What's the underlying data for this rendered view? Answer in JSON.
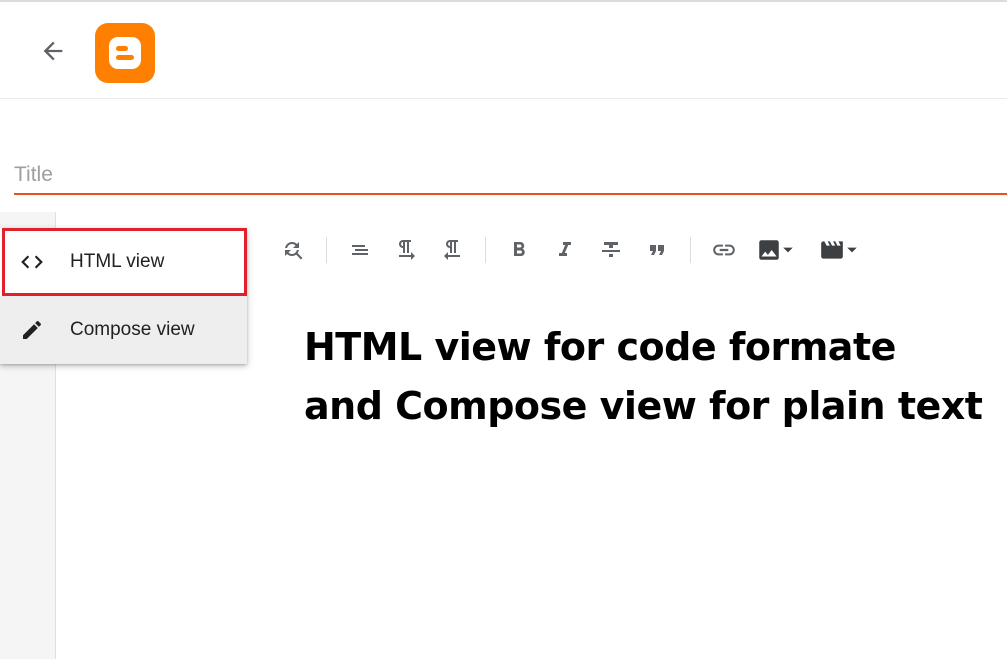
{
  "header": {
    "back_icon": "arrow-left-icon",
    "logo_icon": "blogger-logo-icon",
    "logo_color": "#ff8000"
  },
  "editor": {
    "title_placeholder": "Title",
    "title_value": "",
    "accent_color": "#e8511f"
  },
  "toolbar": {
    "items": [
      "find-replace-icon",
      "align-icon",
      "ltr-icon",
      "rtl-icon",
      "bold-icon",
      "italic-icon",
      "strikethrough-icon",
      "quote-icon",
      "link-icon",
      "insert-image-icon",
      "insert-video-icon"
    ]
  },
  "view_menu": {
    "items": [
      {
        "label": "HTML view",
        "icon": "code-icon"
      },
      {
        "label": "Compose view",
        "icon": "pencil-icon"
      }
    ],
    "highlight_color": "#e0202c"
  },
  "annotation": {
    "line1": "HTML view for code formate",
    "line2": "and Compose view for plain text"
  }
}
